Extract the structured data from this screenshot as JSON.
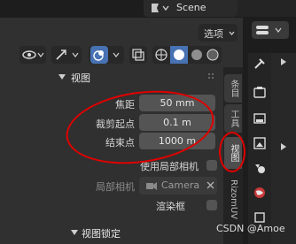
{
  "header": {
    "scene": "Scene",
    "options": "选项"
  },
  "panel": {
    "title": "视图",
    "focal_length": {
      "label": "焦距",
      "value": "50 mm"
    },
    "clip_start": {
      "label": "裁剪起点",
      "value": "0.1 m"
    },
    "clip_end": {
      "label": "结束点",
      "value": "1000 m"
    },
    "lock_camera": {
      "label": "使用局部相机"
    },
    "local_camera": {
      "label": "局部相机",
      "value": "Camera"
    },
    "render_region": {
      "label": "渲染框"
    },
    "view_lock": {
      "title": "视图锁定"
    }
  },
  "tabs": {
    "item": "条目",
    "tool": "工具",
    "view": "视图",
    "rizom": "RizomUV"
  },
  "watermark": "CSDN @Amoe",
  "colors": {
    "accent": "#4772b3",
    "annotation": "#e00000"
  }
}
